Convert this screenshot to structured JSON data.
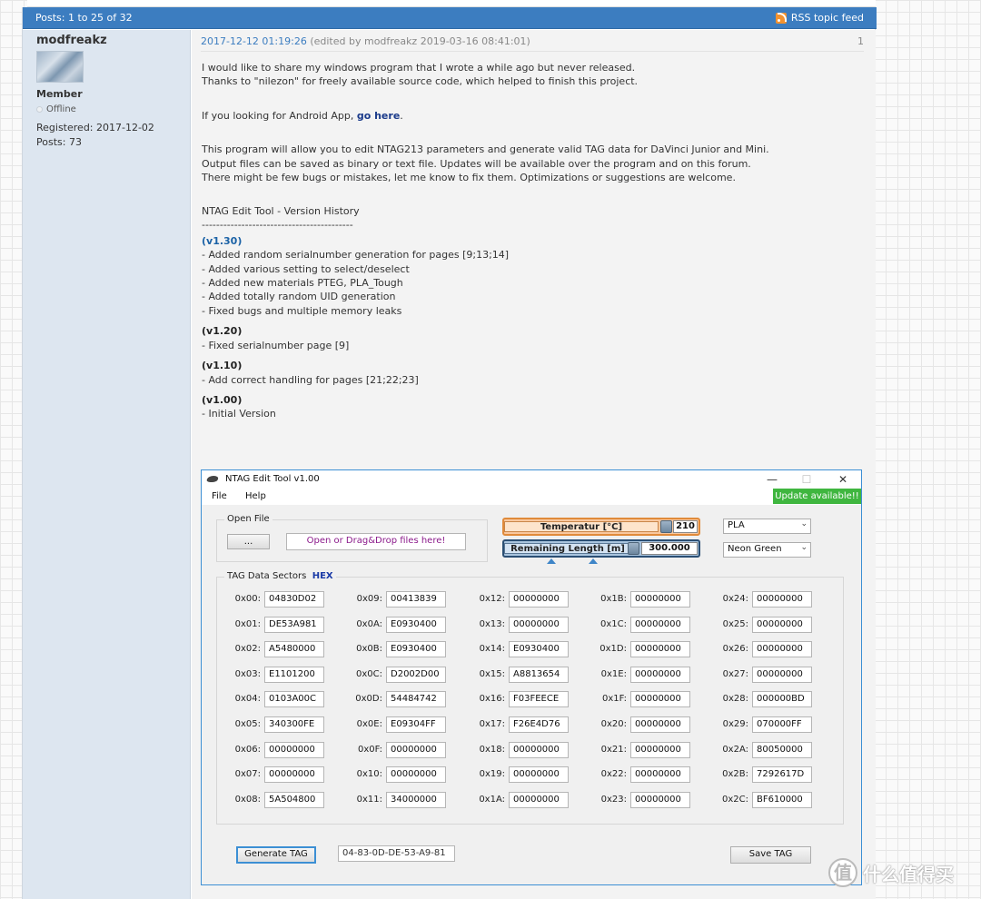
{
  "header": {
    "posts_label": "Posts: 1 to 25 of 32",
    "rss_label": "RSS topic feed"
  },
  "author": {
    "username": "modfreakz",
    "rank": "Member",
    "status": "Offline",
    "registered": "Registered: 2017-12-02",
    "posts": "Posts: 73"
  },
  "post": {
    "date": "2017-12-12 01:19:26",
    "edited": "(edited by modfreakz 2019-03-16 08:41:01)",
    "number": "1",
    "intro1": "I would like to share my windows program that I wrote a while ago but never released.",
    "intro2": "Thanks to \"nilezon\" for freely available source code, which helped to finish this project.",
    "android_prefix": "If you looking for Android App, ",
    "android_link": "go here",
    "android_suffix": ".",
    "desc1": "This program will allow you to edit NTAG213 parameters and generate valid TAG data for DaVinci Junior and Mini.",
    "desc2": "Output files can be saved as binary or text file. Updates will be available over the program and on this forum.",
    "desc3": "There might be few bugs or mistakes, let me know to fix them. Optimizations or suggestions are welcome.",
    "history_title": "NTAG Edit Tool - Version History",
    "history_sep": "------------------------------------------",
    "versions": [
      {
        "label": "(v1.30)",
        "items": [
          "- Added random serialnumber generation for pages [9;13;14]",
          "- Added various setting to select/deselect",
          "- Added new materials PTEG, PLA_Tough",
          "- Added totally random UID generation",
          "- Fixed bugs and multiple memory leaks"
        ]
      },
      {
        "label": "(v1.20)",
        "items": [
          "- Fixed serialnumber page [9]"
        ]
      },
      {
        "label": "(v1.10)",
        "items": [
          "- Add correct handling for pages [21;22;23]"
        ]
      },
      {
        "label": "(v1.00)",
        "items": [
          "- Initial Version"
        ]
      }
    ]
  },
  "app": {
    "title": "NTAG Edit Tool   v1.00",
    "controls": {
      "minimize": "—",
      "maximize": "☐",
      "close": "✕"
    },
    "menu": [
      "File",
      "Help"
    ],
    "update_badge": "Update available!!",
    "open_file": {
      "label": "Open File",
      "browse": "...",
      "drop_text": "Open or Drag&Drop files here!"
    },
    "temperature": {
      "label": "Temperatur   [°C]",
      "value": "210"
    },
    "length": {
      "label": "Remaining Length   [m]",
      "value": "300.000"
    },
    "material": "PLA",
    "color": "Neon Green",
    "sectors_label": "TAG Data Sectors",
    "hex_label": "HEX",
    "sectors": [
      [
        [
          "0x00:",
          "04830D02"
        ],
        [
          "0x01:",
          "DE53A981"
        ],
        [
          "0x02:",
          "A5480000"
        ],
        [
          "0x03:",
          "E1101200"
        ],
        [
          "0x04:",
          "0103A00C"
        ],
        [
          "0x05:",
          "340300FE"
        ],
        [
          "0x06:",
          "00000000"
        ],
        [
          "0x07:",
          "00000000"
        ],
        [
          "0x08:",
          "5A504800"
        ]
      ],
      [
        [
          "0x09:",
          "00413839"
        ],
        [
          "0x0A:",
          "E0930400"
        ],
        [
          "0x0B:",
          "E0930400"
        ],
        [
          "0x0C:",
          "D2002D00"
        ],
        [
          "0x0D:",
          "54484742"
        ],
        [
          "0x0E:",
          "E09304FF"
        ],
        [
          "0x0F:",
          "00000000"
        ],
        [
          "0x10:",
          "00000000"
        ],
        [
          "0x11:",
          "34000000"
        ]
      ],
      [
        [
          "0x12:",
          "00000000"
        ],
        [
          "0x13:",
          "00000000"
        ],
        [
          "0x14:",
          "E0930400"
        ],
        [
          "0x15:",
          "A8813654"
        ],
        [
          "0x16:",
          "F03FEECE"
        ],
        [
          "0x17:",
          "F26E4D76"
        ],
        [
          "0x18:",
          "00000000"
        ],
        [
          "0x19:",
          "00000000"
        ],
        [
          "0x1A:",
          "00000000"
        ]
      ],
      [
        [
          "0x1B:",
          "00000000"
        ],
        [
          "0x1C:",
          "00000000"
        ],
        [
          "0x1D:",
          "00000000"
        ],
        [
          "0x1E:",
          "00000000"
        ],
        [
          "0x1F:",
          "00000000"
        ],
        [
          "0x20:",
          "00000000"
        ],
        [
          "0x21:",
          "00000000"
        ],
        [
          "0x22:",
          "00000000"
        ],
        [
          "0x23:",
          "00000000"
        ]
      ],
      [
        [
          "0x24:",
          "00000000"
        ],
        [
          "0x25:",
          "00000000"
        ],
        [
          "0x26:",
          "00000000"
        ],
        [
          "0x27:",
          "00000000"
        ],
        [
          "0x28:",
          "000000BD"
        ],
        [
          "0x29:",
          "070000FF"
        ],
        [
          "0x2A:",
          "80050000"
        ],
        [
          "0x2B:",
          "7292617D"
        ],
        [
          "0x2C:",
          "BF610000"
        ]
      ]
    ],
    "generate_button": "Generate TAG",
    "uid_value": "04-83-0D-DE-53-A9-81",
    "save_button": "Save TAG"
  },
  "watermark": {
    "glyph": "值",
    "text": "什么值得买"
  },
  "colors": {
    "header_blue": "#3c7dc0",
    "sidebar_bg": "#dde6f0",
    "update_green": "#3fb63f",
    "window_border": "#3c8fd4"
  }
}
